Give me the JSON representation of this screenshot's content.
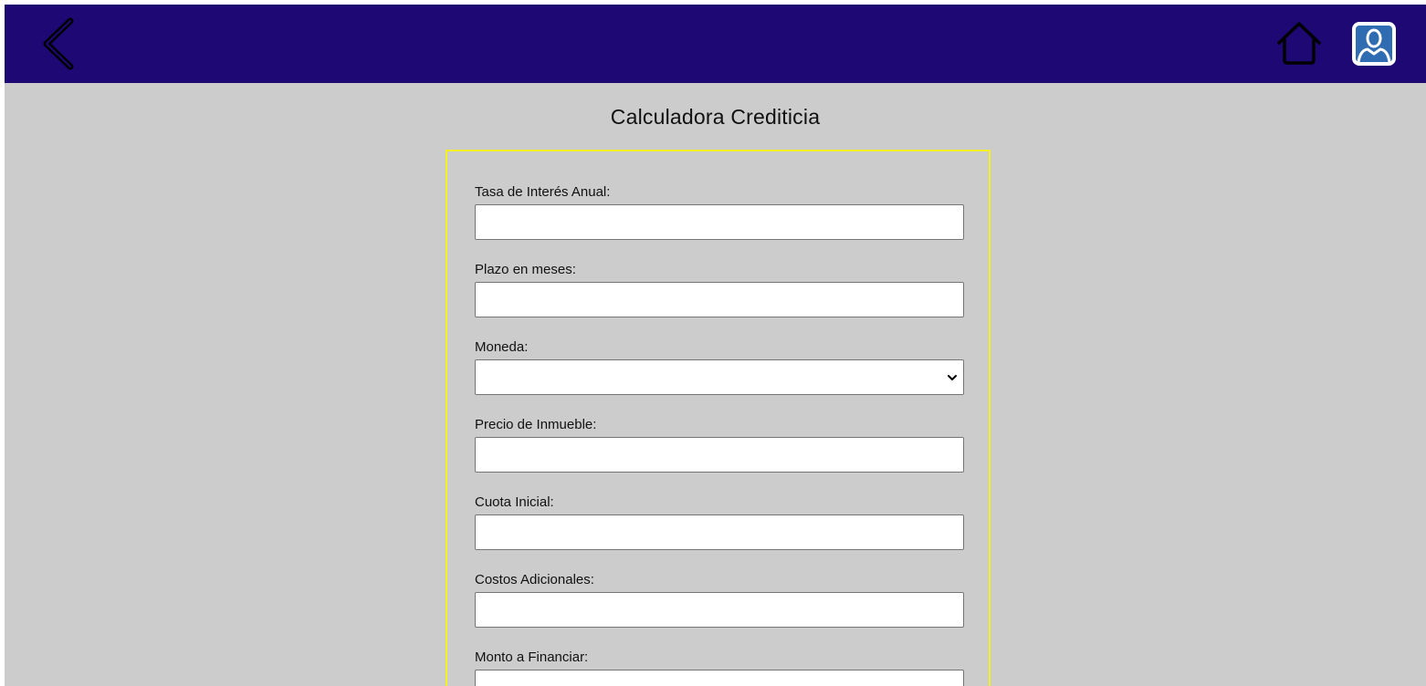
{
  "header": {
    "background": "#1e0873",
    "back_icon": "chevron-left-icon",
    "home_icon": "home-icon",
    "profile_icon": "user-icon"
  },
  "page": {
    "title": "Calculadora Crediticia",
    "panel_border_color": "#f4f022",
    "background": "#cccccc"
  },
  "form": {
    "fields": [
      {
        "label": "Tasa de Interés Anual:",
        "value": "",
        "type": "text"
      },
      {
        "label": "Plazo en meses:",
        "value": "",
        "type": "text"
      },
      {
        "label": "Moneda:",
        "value": "",
        "type": "select"
      },
      {
        "label": "Precio de Inmueble:",
        "value": "",
        "type": "text"
      },
      {
        "label": "Cuota Inicial:",
        "value": "",
        "type": "text"
      },
      {
        "label": "Costos Adicionales:",
        "value": "",
        "type": "text"
      },
      {
        "label": "Monto a Financiar:",
        "value": "",
        "type": "text"
      }
    ]
  }
}
